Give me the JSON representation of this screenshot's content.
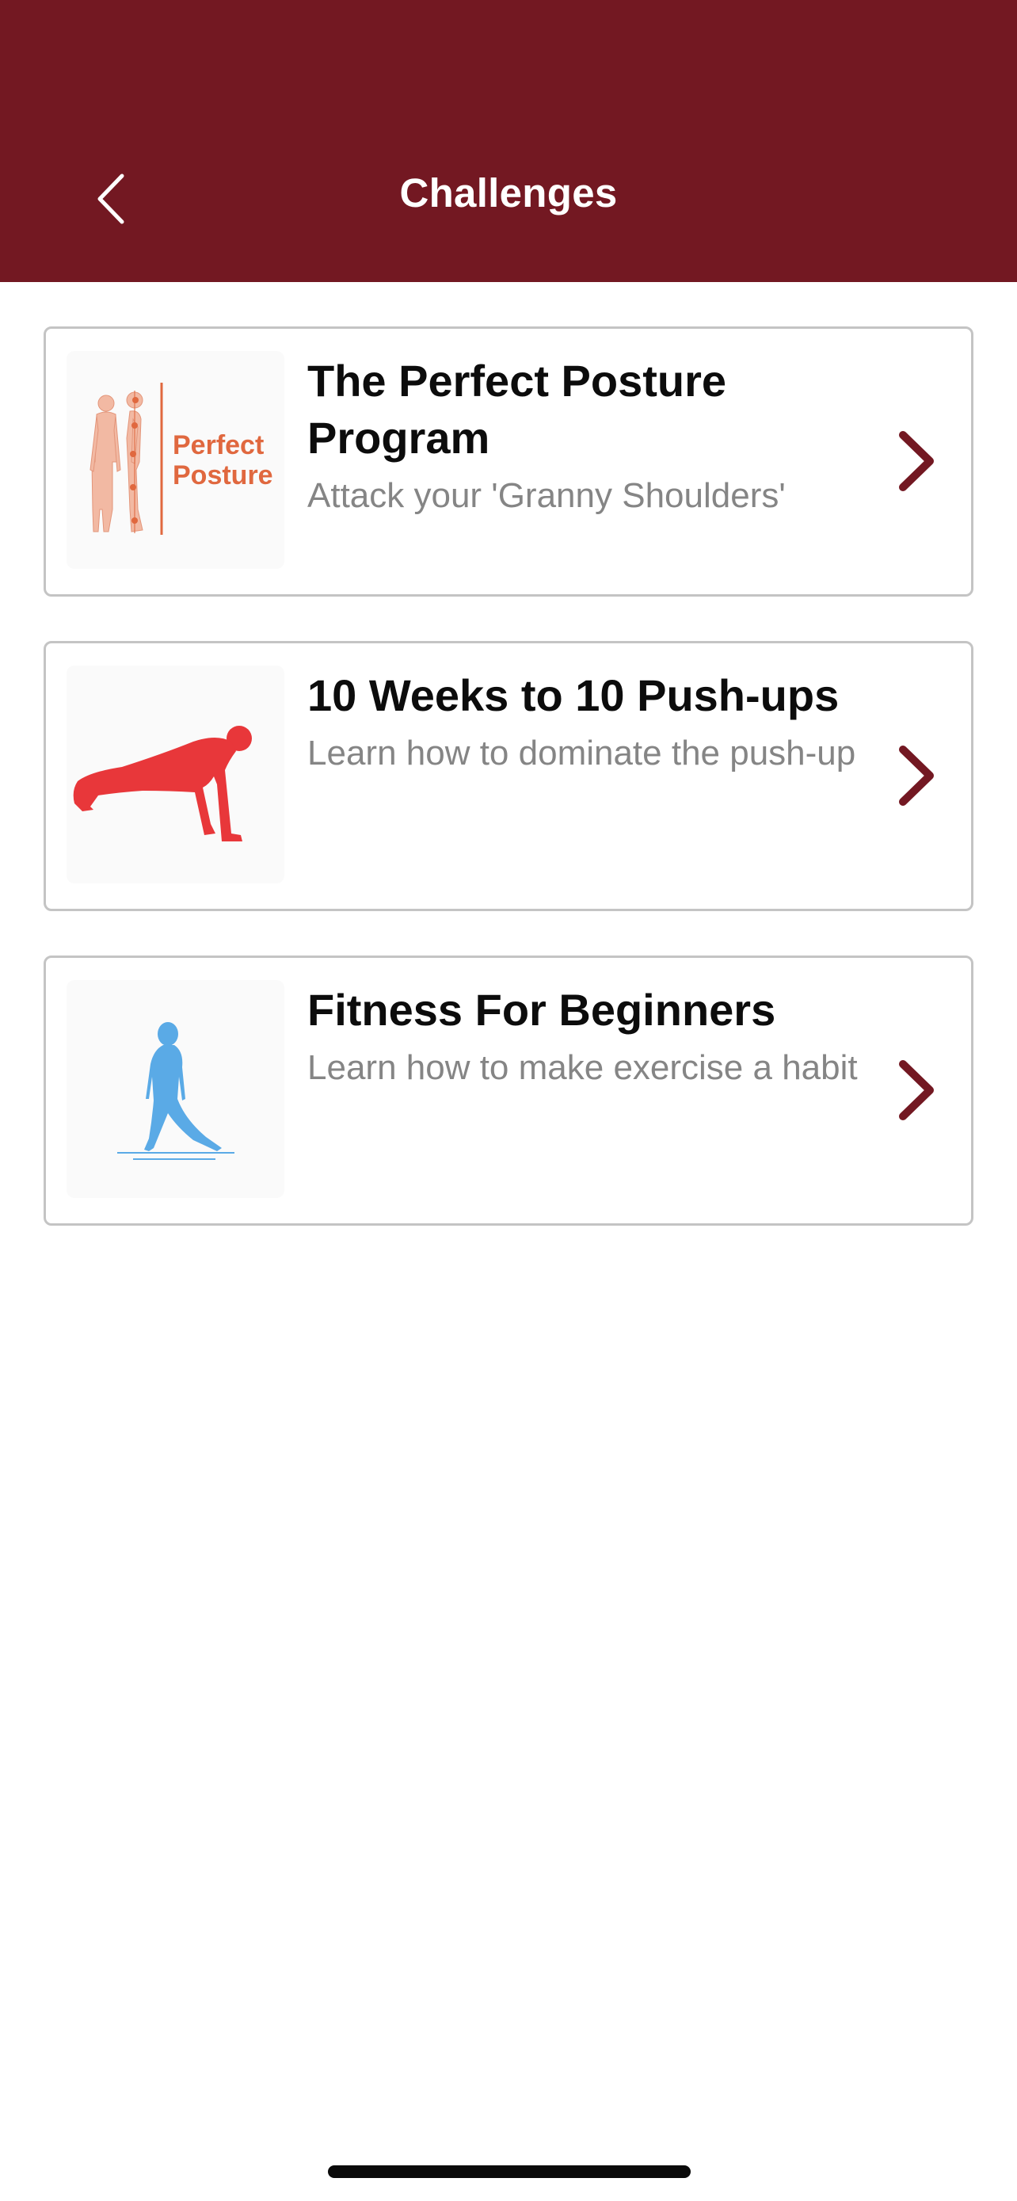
{
  "header": {
    "title": "Challenges",
    "back_icon": "chevron-left-icon",
    "background_color": "#731822"
  },
  "challenges": [
    {
      "title": "The Perfect Posture Program",
      "subtitle": "Attack your 'Granny Shoulders'",
      "thumbnail_text_line1": "Perfect",
      "thumbnail_text_line2": "Posture",
      "thumbnail_icon": "posture-figures-icon",
      "chevron_icon": "chevron-right-icon"
    },
    {
      "title": "10 Weeks to 10 Push-ups",
      "subtitle": "Learn how to dominate the push-up",
      "thumbnail_icon": "pushup-figure-icon",
      "chevron_icon": "chevron-right-icon"
    },
    {
      "title": "Fitness For Beginners",
      "subtitle": "Learn how to make exercise a habit",
      "thumbnail_icon": "stretching-figure-icon",
      "chevron_icon": "chevron-right-icon"
    }
  ],
  "colors": {
    "accent": "#731822",
    "card_border": "#c4c4c4",
    "subtitle_text": "#858585",
    "posture_orange": "#e0683f",
    "pushup_red": "#e8373a",
    "beginner_blue": "#5aaae6"
  }
}
